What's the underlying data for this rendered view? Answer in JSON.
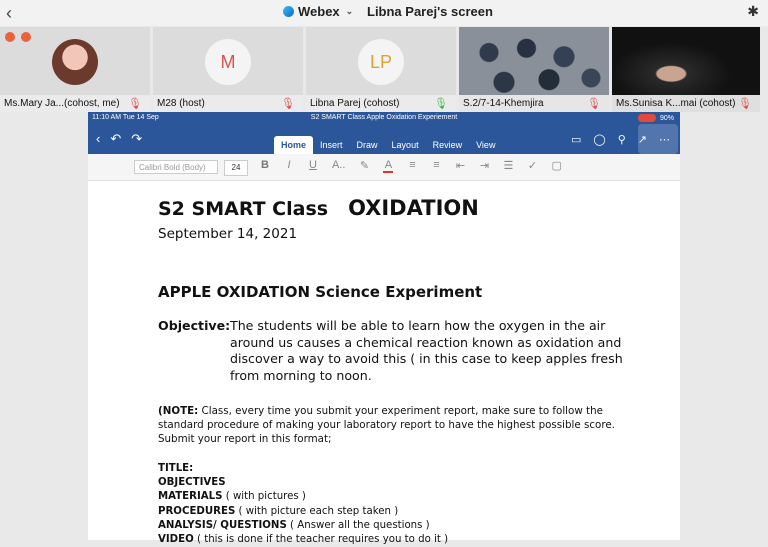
{
  "topbar": {
    "app_name": "Webex",
    "screen_title": "Libna Parej's screen"
  },
  "participants": [
    {
      "label": "Ms.Mary Ja...(cohost, me)",
      "type": "photo"
    },
    {
      "label": "M28 (host)",
      "initials": "M",
      "type": "initials"
    },
    {
      "label": "Libna Parej (cohost)",
      "initials": "LP",
      "type": "initials"
    },
    {
      "label": "S.2/7-14-Khemjira",
      "type": "video"
    },
    {
      "label": "Ms.Sunisa K...mai (cohost)",
      "type": "video"
    }
  ],
  "shared_screen": {
    "status_time": "11:10 AM   Tue 14 Sep",
    "doc_filename": "S2 SMART Class Apple Oxidation Experiement",
    "battery": "90%",
    "tabs": [
      "Home",
      "Insert",
      "Draw",
      "Layout",
      "Review",
      "View"
    ],
    "active_tab": "Home",
    "font_name": "Calibri Bold (Body)",
    "font_size": "24"
  },
  "document": {
    "title_class": "S2 SMART Class",
    "title_topic": "OXIDATION",
    "date": "September 14, 2021",
    "heading": "APPLE OXIDATION Science Experiment",
    "objective_label": "Objective:",
    "objective_text": "The students will be able to learn how the oxygen in the air around us causes a chemical reaction known as oxidation and discover a way to avoid this ( in this case to keep apples fresh from morning to noon.",
    "note_label": "(NOTE:",
    "note_text": " Class, every time you submit your experiment report, make sure to follow the standard procedure of making your laboratory report to have the highest possible score. Submit your report in this format;",
    "list": [
      {
        "bold": "TITLE:",
        "rest": ""
      },
      {
        "bold": "OBJECTIVES",
        "rest": ""
      },
      {
        "bold": "MATERIALS",
        "rest": "  ( with pictures )"
      },
      {
        "bold": "PROCEDURES",
        "rest": " ( with picture each step taken )"
      },
      {
        "bold": "ANALYSIS/ QUESTIONS",
        "rest": " ( Answer all the questions )"
      },
      {
        "bold": "VIDEO",
        "rest": " ( this is done if the teacher requires you to do it )"
      }
    ]
  }
}
